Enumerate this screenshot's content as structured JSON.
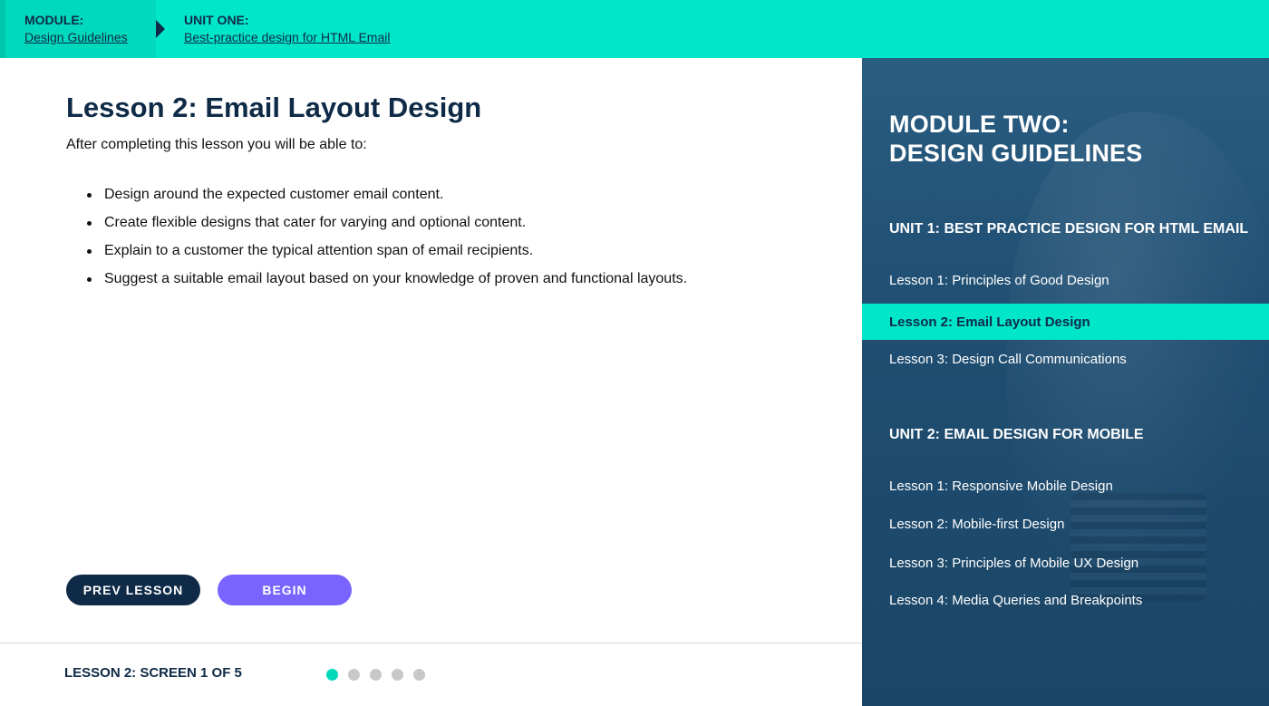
{
  "breadcrumb": {
    "module_label": "MODULE:",
    "module_link": "Design Guidelines",
    "unit_label": "UNIT ONE:",
    "unit_link": "Best-practice design for HTML Email"
  },
  "lesson": {
    "title": "Lesson 2: Email Layout Design",
    "intro": "After completing this lesson you will be able to:",
    "objectives": [
      "Design around the expected customer email content.",
      "Create flexible designs that cater for varying and optional content.",
      "Explain to a customer the typical attention span of email recipients.",
      "Suggest a suitable email layout based on your knowledge of proven and functional layouts."
    ]
  },
  "buttons": {
    "prev": "PREV LESSON",
    "begin": "BEGIN"
  },
  "footer": {
    "screen_counter": "LESSON 2: SCREEN 1 OF 5",
    "total_screens": 5,
    "current_screen": 1
  },
  "sidebar": {
    "module_title_line1": "MODULE TWO:",
    "module_title_line2": "DESIGN GUIDELINES",
    "units": [
      {
        "title": "UNIT 1: BEST PRACTICE DESIGN FOR HTML EMAIL",
        "lessons": [
          {
            "label": "Lesson 1: Principles of Good Design",
            "active": false
          },
          {
            "label": "Lesson 2: Email Layout Design",
            "active": true
          },
          {
            "label": "Lesson 3: Design Call Communications",
            "active": false
          }
        ]
      },
      {
        "title": "UNIT 2: EMAIL DESIGN FOR MOBILE",
        "lessons": [
          {
            "label": "Lesson 1: Responsive Mobile Design",
            "active": false
          },
          {
            "label": "Lesson 2: Mobile-first Design",
            "active": false
          },
          {
            "label": "Lesson 3: Principles of Mobile UX Design",
            "active": false
          },
          {
            "label": "Lesson 4: Media Queries and Breakpoints",
            "active": false
          }
        ]
      }
    ]
  },
  "colors": {
    "accent": "#00e6c8",
    "navy": "#0e2a47",
    "begin_button": "#7a64ff",
    "sidebar_bg": "#1f4e72"
  }
}
